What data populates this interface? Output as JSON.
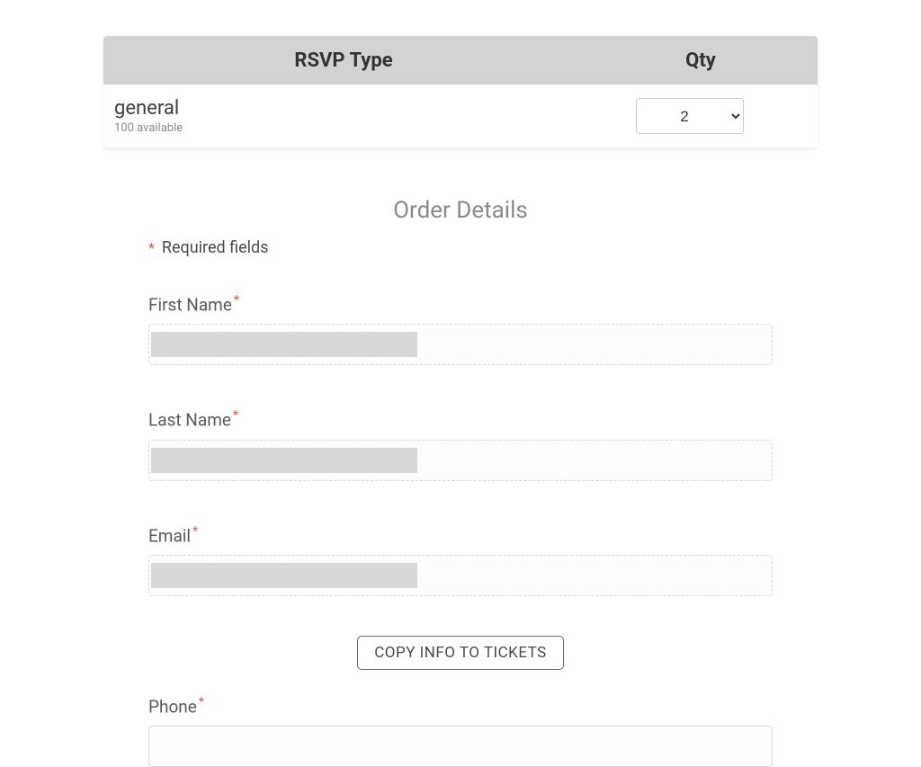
{
  "rsvp_table": {
    "headers": {
      "type": "RSVP Type",
      "qty": "Qty"
    },
    "row": {
      "name": "general",
      "available_text": "100 available",
      "qty_value": "2"
    }
  },
  "order": {
    "title": "Order Details",
    "required_note": "Required fields",
    "fields": {
      "first_name_label": "First Name",
      "last_name_label": "Last Name",
      "email_label": "Email",
      "phone_label": "Phone"
    },
    "copy_button": "COPY INFO TO TICKETS"
  }
}
